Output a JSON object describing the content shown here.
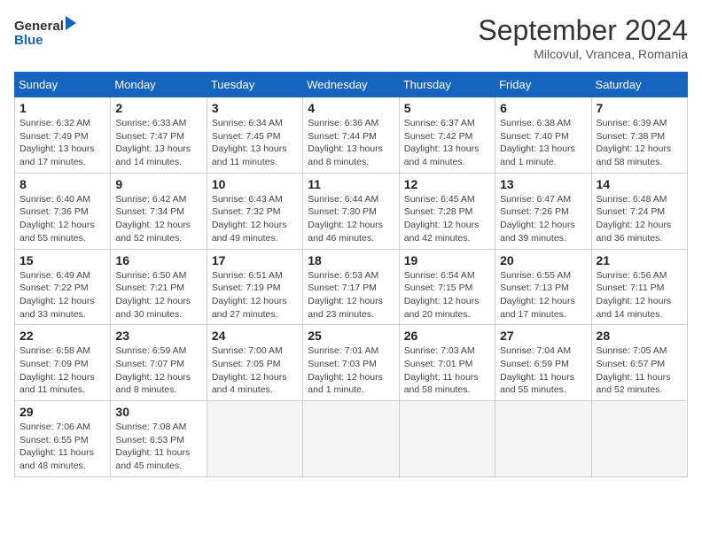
{
  "header": {
    "logo_line1": "General",
    "logo_line2": "Blue",
    "month": "September 2024",
    "location": "Milcovul, Vrancea, Romania"
  },
  "weekdays": [
    "Sunday",
    "Monday",
    "Tuesday",
    "Wednesday",
    "Thursday",
    "Friday",
    "Saturday"
  ],
  "weeks": [
    [
      {
        "day": "1",
        "info": "Sunrise: 6:32 AM\nSunset: 7:49 PM\nDaylight: 13 hours and 17 minutes."
      },
      {
        "day": "2",
        "info": "Sunrise: 6:33 AM\nSunset: 7:47 PM\nDaylight: 13 hours and 14 minutes."
      },
      {
        "day": "3",
        "info": "Sunrise: 6:34 AM\nSunset: 7:45 PM\nDaylight: 13 hours and 11 minutes."
      },
      {
        "day": "4",
        "info": "Sunrise: 6:36 AM\nSunset: 7:44 PM\nDaylight: 13 hours and 8 minutes."
      },
      {
        "day": "5",
        "info": "Sunrise: 6:37 AM\nSunset: 7:42 PM\nDaylight: 13 hours and 4 minutes."
      },
      {
        "day": "6",
        "info": "Sunrise: 6:38 AM\nSunset: 7:40 PM\nDaylight: 13 hours and 1 minute."
      },
      {
        "day": "7",
        "info": "Sunrise: 6:39 AM\nSunset: 7:38 PM\nDaylight: 12 hours and 58 minutes."
      }
    ],
    [
      {
        "day": "8",
        "info": "Sunrise: 6:40 AM\nSunset: 7:36 PM\nDaylight: 12 hours and 55 minutes."
      },
      {
        "day": "9",
        "info": "Sunrise: 6:42 AM\nSunset: 7:34 PM\nDaylight: 12 hours and 52 minutes."
      },
      {
        "day": "10",
        "info": "Sunrise: 6:43 AM\nSunset: 7:32 PM\nDaylight: 12 hours and 49 minutes."
      },
      {
        "day": "11",
        "info": "Sunrise: 6:44 AM\nSunset: 7:30 PM\nDaylight: 12 hours and 46 minutes."
      },
      {
        "day": "12",
        "info": "Sunrise: 6:45 AM\nSunset: 7:28 PM\nDaylight: 12 hours and 42 minutes."
      },
      {
        "day": "13",
        "info": "Sunrise: 6:47 AM\nSunset: 7:26 PM\nDaylight: 12 hours and 39 minutes."
      },
      {
        "day": "14",
        "info": "Sunrise: 6:48 AM\nSunset: 7:24 PM\nDaylight: 12 hours and 36 minutes."
      }
    ],
    [
      {
        "day": "15",
        "info": "Sunrise: 6:49 AM\nSunset: 7:22 PM\nDaylight: 12 hours and 33 minutes."
      },
      {
        "day": "16",
        "info": "Sunrise: 6:50 AM\nSunset: 7:21 PM\nDaylight: 12 hours and 30 minutes."
      },
      {
        "day": "17",
        "info": "Sunrise: 6:51 AM\nSunset: 7:19 PM\nDaylight: 12 hours and 27 minutes."
      },
      {
        "day": "18",
        "info": "Sunrise: 6:53 AM\nSunset: 7:17 PM\nDaylight: 12 hours and 23 minutes."
      },
      {
        "day": "19",
        "info": "Sunrise: 6:54 AM\nSunset: 7:15 PM\nDaylight: 12 hours and 20 minutes."
      },
      {
        "day": "20",
        "info": "Sunrise: 6:55 AM\nSunset: 7:13 PM\nDaylight: 12 hours and 17 minutes."
      },
      {
        "day": "21",
        "info": "Sunrise: 6:56 AM\nSunset: 7:11 PM\nDaylight: 12 hours and 14 minutes."
      }
    ],
    [
      {
        "day": "22",
        "info": "Sunrise: 6:58 AM\nSunset: 7:09 PM\nDaylight: 12 hours and 11 minutes."
      },
      {
        "day": "23",
        "info": "Sunrise: 6:59 AM\nSunset: 7:07 PM\nDaylight: 12 hours and 8 minutes."
      },
      {
        "day": "24",
        "info": "Sunrise: 7:00 AM\nSunset: 7:05 PM\nDaylight: 12 hours and 4 minutes."
      },
      {
        "day": "25",
        "info": "Sunrise: 7:01 AM\nSunset: 7:03 PM\nDaylight: 12 hours and 1 minute."
      },
      {
        "day": "26",
        "info": "Sunrise: 7:03 AM\nSunset: 7:01 PM\nDaylight: 11 hours and 58 minutes."
      },
      {
        "day": "27",
        "info": "Sunrise: 7:04 AM\nSunset: 6:59 PM\nDaylight: 11 hours and 55 minutes."
      },
      {
        "day": "28",
        "info": "Sunrise: 7:05 AM\nSunset: 6:57 PM\nDaylight: 11 hours and 52 minutes."
      }
    ],
    [
      {
        "day": "29",
        "info": "Sunrise: 7:06 AM\nSunset: 6:55 PM\nDaylight: 11 hours and 48 minutes."
      },
      {
        "day": "30",
        "info": "Sunrise: 7:08 AM\nSunset: 6:53 PM\nDaylight: 11 hours and 45 minutes."
      },
      null,
      null,
      null,
      null,
      null
    ]
  ]
}
